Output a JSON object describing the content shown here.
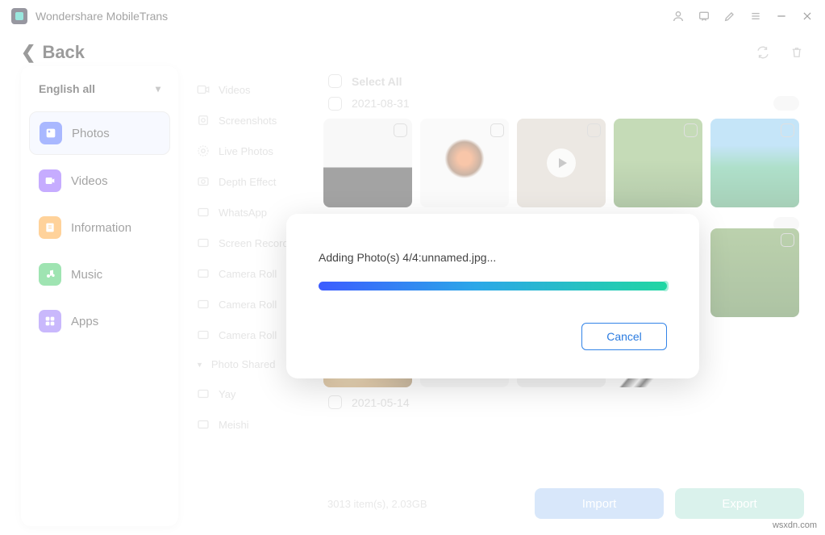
{
  "app": {
    "title": "Wondershare MobileTrans"
  },
  "back": {
    "label": "Back"
  },
  "dropdown": {
    "label": "English all"
  },
  "sidebar": {
    "items": [
      {
        "label": "Photos",
        "active": true
      },
      {
        "label": "Videos"
      },
      {
        "label": "Information"
      },
      {
        "label": "Music"
      },
      {
        "label": "Apps"
      }
    ]
  },
  "categories": {
    "items": [
      {
        "label": "Videos"
      },
      {
        "label": "Screenshots"
      },
      {
        "label": "Live Photos"
      },
      {
        "label": "Depth Effect"
      },
      {
        "label": "WhatsApp"
      },
      {
        "label": "Screen Recorder"
      },
      {
        "label": "Camera Roll"
      },
      {
        "label": "Camera Roll"
      },
      {
        "label": "Camera Roll"
      },
      {
        "label": "Photo Shared",
        "section": true
      },
      {
        "label": "Yay"
      },
      {
        "label": "Meishi"
      }
    ]
  },
  "content": {
    "select_all": "Select All",
    "dates": [
      "2021-08-31",
      "2021-05-14"
    ],
    "summary": "3013 item(s), 2.03GB"
  },
  "actions": {
    "import": "Import",
    "export": "Export"
  },
  "modal": {
    "message": "Adding Photo(s) 4/4:unnamed.jpg...",
    "cancel": "Cancel",
    "progress_percent": 100
  },
  "watermark": "wsxdn.com"
}
